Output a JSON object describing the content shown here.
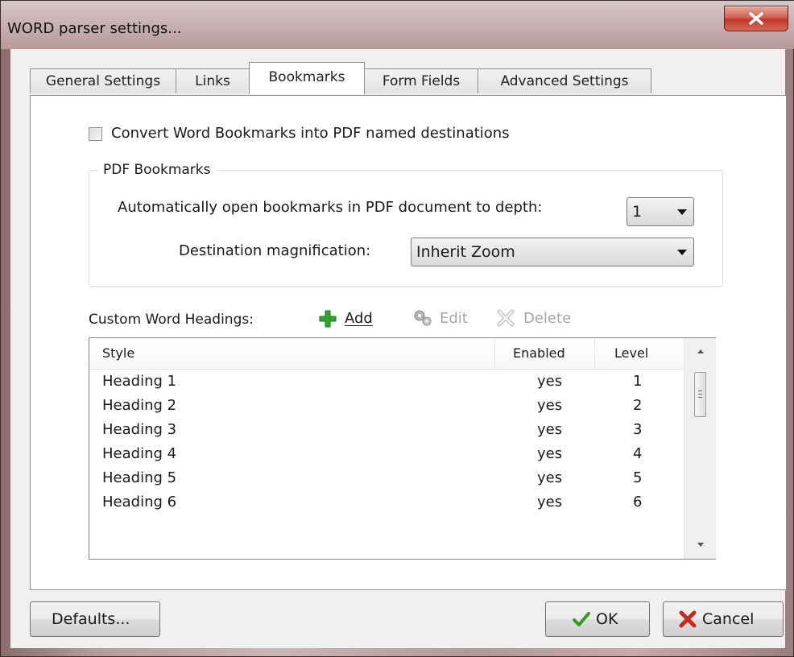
{
  "window": {
    "title": "WORD parser settings..."
  },
  "tabs": [
    {
      "label": "General Settings"
    },
    {
      "label": "Links"
    },
    {
      "label": "Bookmarks"
    },
    {
      "label": "Form Fields"
    },
    {
      "label": "Advanced Settings"
    }
  ],
  "active_tab": "Bookmarks",
  "bookmarks": {
    "convert_checkbox": {
      "label": "Convert Word Bookmarks into PDF named destinations",
      "checked": false
    },
    "pdf_group": {
      "title": "PDF Bookmarks",
      "depth_label": "Automatically open bookmarks in PDF document to depth:",
      "depth_value": "1",
      "magnification_label": "Destination magnification:",
      "magnification_value": "Inherit Zoom"
    },
    "headings_label": "Custom Word Headings:",
    "toolbar": {
      "add": "Add",
      "edit": "Edit",
      "delete": "Delete"
    },
    "list": {
      "columns": [
        "Style",
        "Enabled",
        "Level"
      ],
      "rows": [
        {
          "style": "Heading 1",
          "enabled": "yes",
          "level": "1"
        },
        {
          "style": "Heading 2",
          "enabled": "yes",
          "level": "2"
        },
        {
          "style": "Heading 3",
          "enabled": "yes",
          "level": "3"
        },
        {
          "style": "Heading 4",
          "enabled": "yes",
          "level": "4"
        },
        {
          "style": "Heading 5",
          "enabled": "yes",
          "level": "5"
        },
        {
          "style": "Heading 6",
          "enabled": "yes",
          "level": "6"
        }
      ]
    }
  },
  "footer": {
    "defaults": "Defaults...",
    "ok": "OK",
    "cancel": "Cancel"
  },
  "colors": {
    "add_icon": "#2fa52f",
    "ok_check": "#3a9a1e",
    "cancel_x": "#c8281e"
  }
}
